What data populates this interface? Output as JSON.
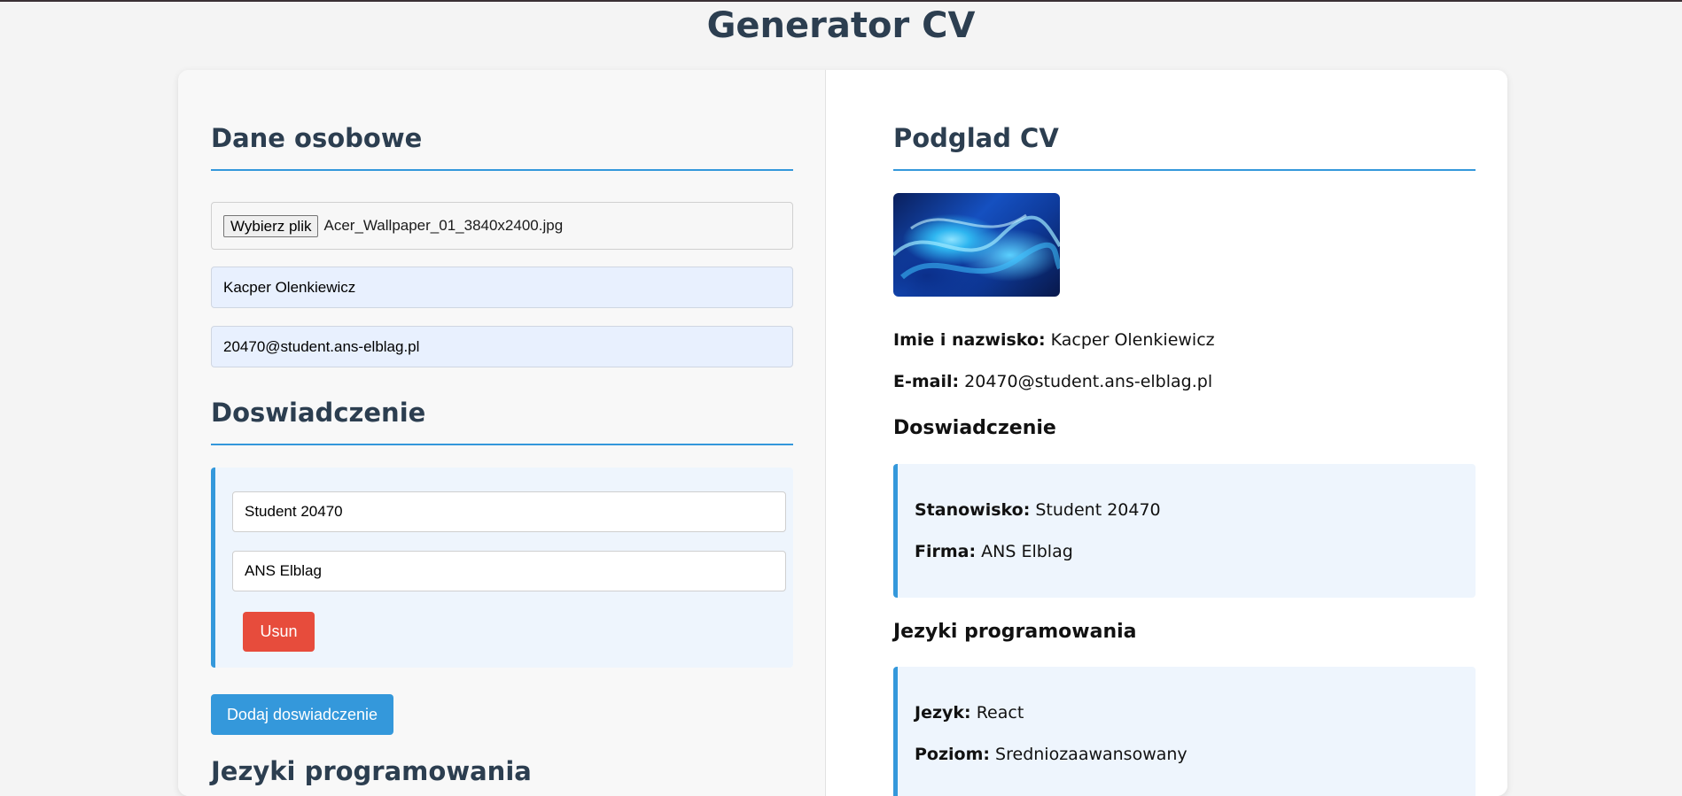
{
  "page": {
    "title": "Generator CV"
  },
  "form": {
    "personal_heading": "Dane osobowe",
    "file_button": "Wybierz plik",
    "file_name": "Acer_Wallpaper_01_3840x2400.jpg",
    "name_value": "Kacper Olenkiewicz",
    "email_value": "20470@student.ans-elblag.pl",
    "experience_heading": "Doswiadczenie",
    "experience": [
      {
        "position": "Student 20470",
        "company": "ANS Elblag",
        "remove_label": "Usun"
      }
    ],
    "add_experience_label": "Dodaj doswiadczenie",
    "languages_heading_partial": "Jezyki programowania"
  },
  "preview": {
    "heading": "Podglad CV",
    "name_label": "Imie i nazwisko:",
    "name_value": "Kacper Olenkiewicz",
    "email_label": "E-mail:",
    "email_value": "20470@student.ans-elblag.pl",
    "experience_heading": "Doswiadczenie",
    "position_label": "Stanowisko:",
    "position_value": "Student 20470",
    "company_label": "Firma:",
    "company_value": "ANS Elblag",
    "languages_heading": "Jezyki programowania",
    "language_label": "Jezyk:",
    "language_value": "React",
    "level_label": "Poziom:",
    "level_value": "Sredniozaawansowany"
  },
  "colors": {
    "accent": "#3498db",
    "danger": "#e74c3c",
    "heading": "#2c3e50",
    "block_bg": "#eef5fd"
  }
}
